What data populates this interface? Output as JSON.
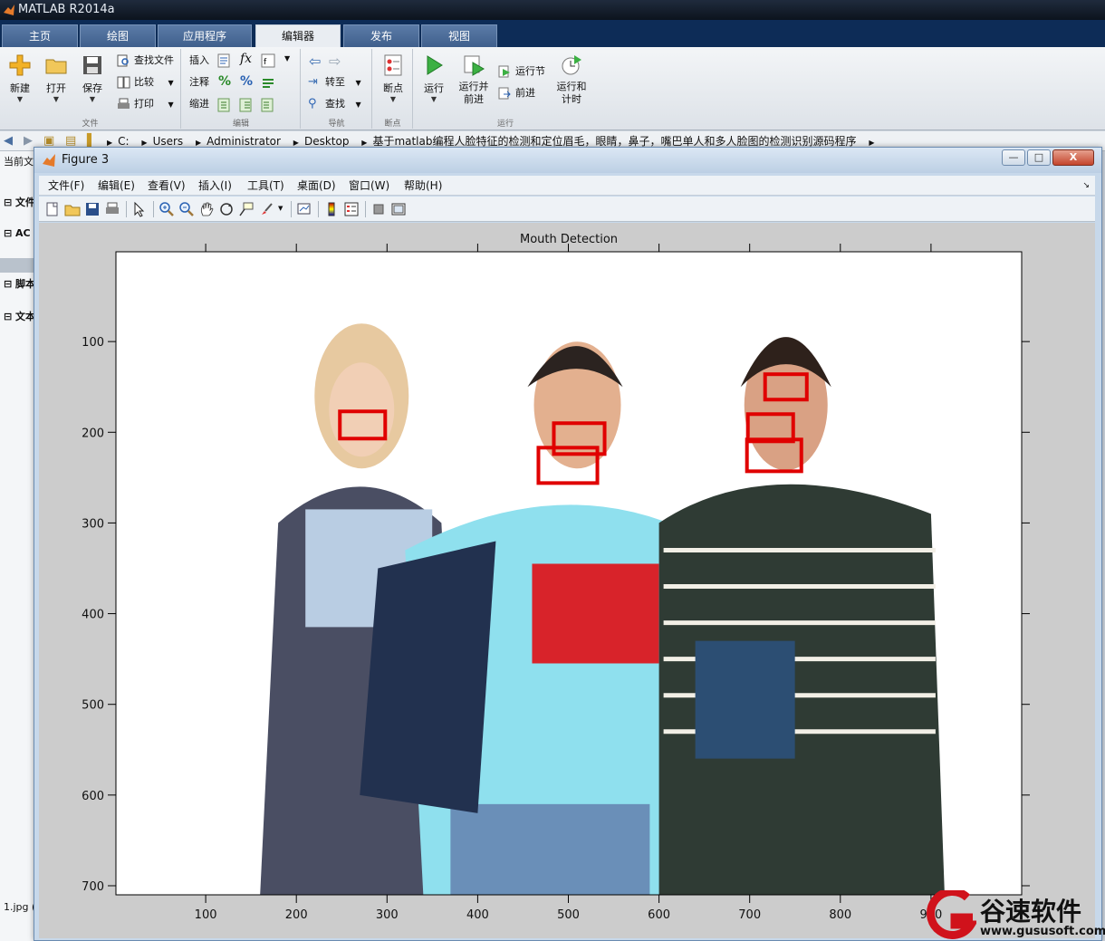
{
  "app": {
    "title": "MATLAB R2014a",
    "tabs": [
      "主页",
      "绘图",
      "应用程序",
      "编辑器",
      "发布",
      "视图"
    ],
    "active_tab": "编辑器"
  },
  "ribbon": {
    "file": {
      "label": "文件",
      "new": "新建",
      "open": "打开",
      "save": "保存",
      "find_files": "查找文件",
      "compare": "比较",
      "print": "打印"
    },
    "edit": {
      "label": "编辑",
      "insert": "插入",
      "comment": "注释",
      "indent": "缩进"
    },
    "navigate": {
      "label": "导航",
      "goto": "转至",
      "find": "查找"
    },
    "breakpoints": {
      "label": "断点",
      "breakpoints": "断点"
    },
    "run": {
      "label": "运行",
      "run": "运行",
      "run_advance_1": "运行并",
      "run_advance_2": "前进",
      "run_section": "运行节",
      "advance": "前进",
      "run_time_1": "运行和",
      "run_time_2": "计时"
    }
  },
  "address": {
    "crumbs": [
      "C:",
      "Users",
      "Administrator",
      "Desktop",
      "基于matlab编程人脸特征的检测和定位眉毛，眼睛，鼻子，嘴巴单人和多人脸图的检测识别源码程序"
    ]
  },
  "left_panel": {
    "title": "当前文",
    "items": [
      "文件",
      "AC",
      "脚本",
      "文本"
    ],
    "file": "1.jpg ("
  },
  "figure": {
    "title": "Figure 3",
    "menu": [
      "文件(F)",
      "编辑(E)",
      "查看(V)",
      "插入(I)",
      "工具(T)",
      "桌面(D)",
      "窗口(W)",
      "帮助(H)"
    ],
    "window_buttons": {
      "min": "—",
      "max": "□",
      "close": "X"
    },
    "toolbar_icons": [
      "new-figure-icon",
      "open-file-icon",
      "save-figure-icon",
      "print-figure-icon",
      "edit-plot-icon",
      "zoom-in-icon",
      "zoom-out-icon",
      "pan-icon",
      "rotate-3d-icon",
      "data-cursor-icon",
      "brush-icon",
      "link-plot-icon",
      "insert-colorbar-icon",
      "insert-legend-icon",
      "hide-plot-tools-icon",
      "show-plot-tools-icon"
    ]
  },
  "plot": {
    "title": "Mouth Detection",
    "x_ticks": [
      "100",
      "200",
      "300",
      "400",
      "500",
      "600",
      "700",
      "800",
      "900"
    ],
    "y_ticks": [
      "100",
      "200",
      "300",
      "400",
      "500",
      "600",
      "700"
    ],
    "xlim": [
      1,
      1000
    ],
    "ylim": [
      1,
      710
    ],
    "box_color": "#e00000",
    "detections": [
      {
        "x": 248,
        "y": 177,
        "w": 50,
        "h": 30
      },
      {
        "x": 484,
        "y": 190,
        "w": 56,
        "h": 34
      },
      {
        "x": 467,
        "y": 217,
        "w": 65,
        "h": 39
      },
      {
        "x": 717,
        "y": 136,
        "w": 46,
        "h": 28
      },
      {
        "x": 698,
        "y": 180,
        "w": 50,
        "h": 30
      },
      {
        "x": 697,
        "y": 208,
        "w": 60,
        "h": 35
      }
    ]
  },
  "watermark": {
    "name": "谷速软件",
    "url": "www.gususoft.com"
  }
}
